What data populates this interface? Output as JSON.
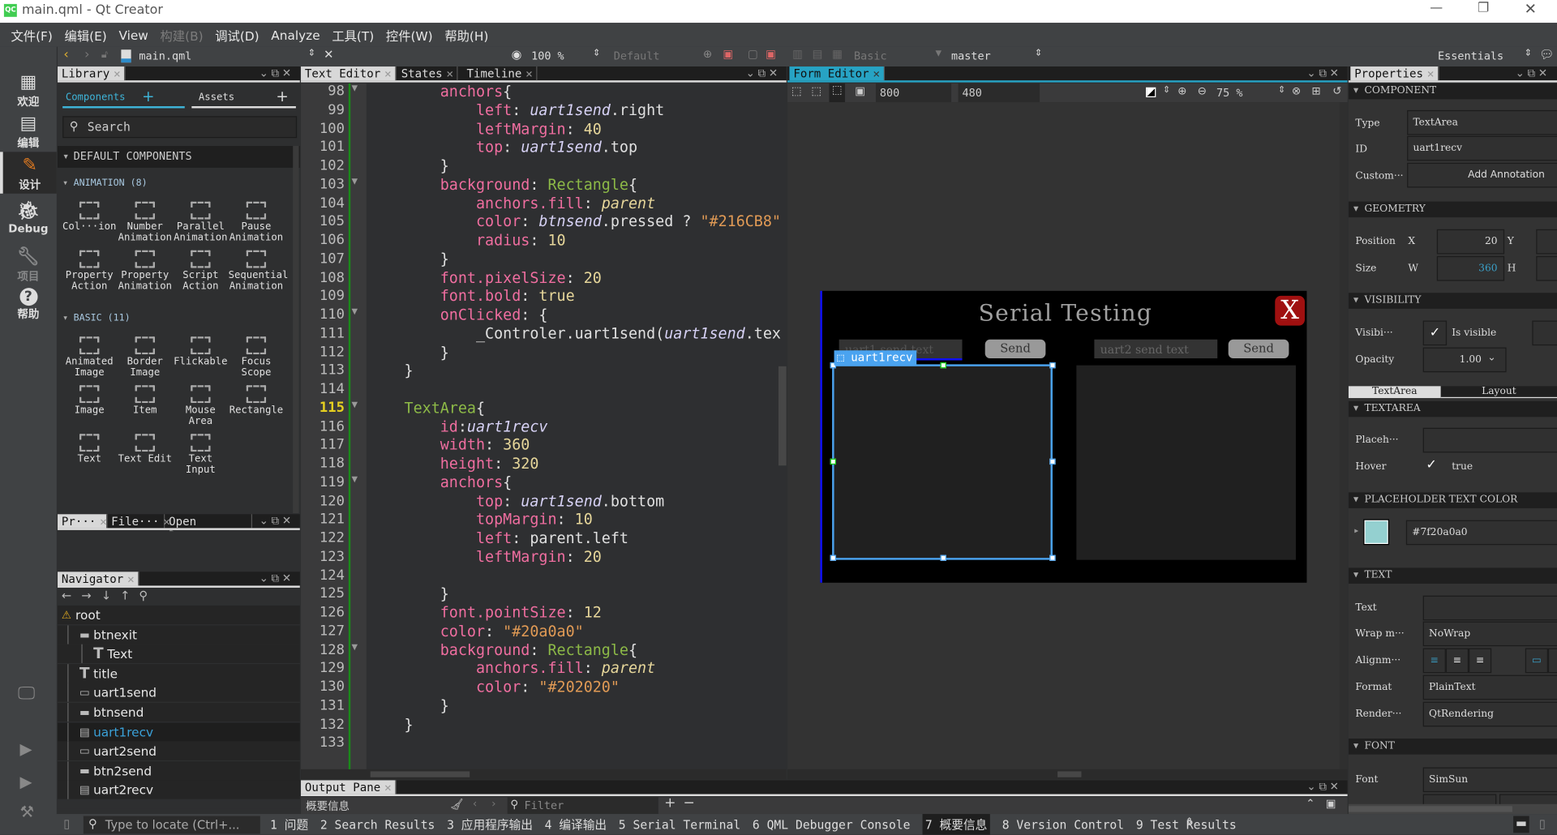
{
  "window": {
    "title": "main.qml - Qt Creator",
    "controls": [
      "minimize",
      "restore",
      "close"
    ]
  },
  "menu": [
    {
      "label": "文件(F)",
      "enabled": true
    },
    {
      "label": "编辑(E)",
      "enabled": true
    },
    {
      "label": "View",
      "enabled": true
    },
    {
      "label": "构建(B)",
      "enabled": false
    },
    {
      "label": "调试(D)",
      "enabled": true
    },
    {
      "label": "Analyze",
      "enabled": true
    },
    {
      "label": "工具(T)",
      "enabled": true
    },
    {
      "label": "控件(W)",
      "enabled": true
    },
    {
      "label": "帮助(H)",
      "enabled": true
    }
  ],
  "toolbar": {
    "file": "main.qml",
    "zoom": "100 %",
    "style": "Default",
    "theme": "Basic",
    "branch": "master",
    "workspace": "Essentials"
  },
  "modes": [
    {
      "label": "欢迎",
      "icon": "grid-icon"
    },
    {
      "label": "编辑",
      "icon": "document-icon"
    },
    {
      "label": "设计",
      "icon": "pencil-icon",
      "active": true
    },
    {
      "label": "Debug",
      "icon": "bug-icon"
    },
    {
      "label": "项目",
      "icon": "wrench-icon",
      "enabled": false
    },
    {
      "label": "帮助",
      "icon": "help-icon"
    }
  ],
  "library": {
    "tab": "Library",
    "subtabs": [
      "Components",
      "Assets"
    ],
    "search_placeholder": "Search",
    "default_header": "DEFAULT COMPONENTS",
    "groups": [
      {
        "title": "ANIMATION (8)",
        "items": [
          "Col···ion",
          "Number Animation",
          "Parallel Animation",
          "Pause Animation",
          "Property Action",
          "Property Animation",
          "Script Action",
          "Sequential Animation"
        ]
      },
      {
        "title": "BASIC (11)",
        "items": [
          "Animated Image",
          "Border Image",
          "Flickable",
          "Focus Scope",
          "Image",
          "Item",
          "Mouse Area",
          "Rectangle",
          "Text",
          "Text Edit",
          "Text Input"
        ]
      }
    ]
  },
  "lower_tabs": [
    "Pr···",
    "File···",
    "Open Do···"
  ],
  "navigator": {
    "tab": "Navigator",
    "items": [
      {
        "label": "root",
        "icon": "warning-icon",
        "depth": 0
      },
      {
        "label": "btnexit",
        "icon": "button-icon",
        "depth": 1
      },
      {
        "label": "Text",
        "icon": "text-icon",
        "depth": 2
      },
      {
        "label": "title",
        "icon": "text-icon",
        "depth": 1
      },
      {
        "label": "uart1send",
        "icon": "textfield-icon",
        "depth": 1
      },
      {
        "label": "btnsend",
        "icon": "button-icon",
        "depth": 1
      },
      {
        "label": "uart1recv",
        "icon": "textarea-icon",
        "depth": 1,
        "selected": true
      },
      {
        "label": "uart2send",
        "icon": "textfield-icon",
        "depth": 1
      },
      {
        "label": "btn2send",
        "icon": "button-icon",
        "depth": 1
      },
      {
        "label": "uart2recv",
        "icon": "textarea-icon",
        "depth": 1
      }
    ]
  },
  "editor_tabs": [
    "Text Editor",
    "States",
    "Timeline"
  ],
  "code": {
    "current_line": 115,
    "lines": [
      {
        "n": 98,
        "fold": true,
        "tokens": [
          [
            "        anchors",
            "p"
          ],
          [
            "{",
            "n"
          ]
        ]
      },
      {
        "n": 99,
        "tokens": [
          [
            "            left",
            "p"
          ],
          [
            ": ",
            "n"
          ],
          [
            "uart1send",
            "i"
          ],
          [
            ".right",
            "n"
          ]
        ]
      },
      {
        "n": 100,
        "tokens": [
          [
            "            leftMargin",
            "p"
          ],
          [
            ": ",
            "n"
          ],
          [
            "40",
            "v"
          ]
        ]
      },
      {
        "n": 101,
        "tokens": [
          [
            "            top",
            "p"
          ],
          [
            ": ",
            "n"
          ],
          [
            "uart1send",
            "i"
          ],
          [
            ".top",
            "n"
          ]
        ]
      },
      {
        "n": 102,
        "tokens": [
          [
            "        }",
            "n"
          ]
        ]
      },
      {
        "n": 103,
        "fold": true,
        "tokens": [
          [
            "        background",
            "p"
          ],
          [
            ": ",
            "n"
          ],
          [
            "Rectangle",
            "t"
          ],
          [
            "{",
            "n"
          ]
        ]
      },
      {
        "n": 104,
        "tokens": [
          [
            "            anchors.fill",
            "p"
          ],
          [
            ": ",
            "n"
          ],
          [
            "parent",
            "pi"
          ]
        ]
      },
      {
        "n": 105,
        "tokens": [
          [
            "            color",
            "p"
          ],
          [
            ": ",
            "n"
          ],
          [
            "btnsend",
            "i"
          ],
          [
            ".pressed ? ",
            "n"
          ],
          [
            "\"#216CB8\"",
            "s"
          ]
        ]
      },
      {
        "n": 106,
        "tokens": [
          [
            "            radius",
            "p"
          ],
          [
            ": ",
            "n"
          ],
          [
            "10",
            "v"
          ]
        ]
      },
      {
        "n": 107,
        "tokens": [
          [
            "        }",
            "n"
          ]
        ]
      },
      {
        "n": 108,
        "tokens": [
          [
            "        font.pixelSize",
            "p"
          ],
          [
            ": ",
            "n"
          ],
          [
            "20",
            "v"
          ]
        ]
      },
      {
        "n": 109,
        "tokens": [
          [
            "        font.bold",
            "p"
          ],
          [
            ": ",
            "n"
          ],
          [
            "true",
            "v"
          ]
        ]
      },
      {
        "n": 110,
        "fold": true,
        "tokens": [
          [
            "        onClicked",
            "p"
          ],
          [
            ": {",
            "n"
          ]
        ]
      },
      {
        "n": 111,
        "tokens": [
          [
            "            _Controler.uart1send(",
            "n"
          ],
          [
            "uart1send",
            "i"
          ],
          [
            ".tex",
            "n"
          ]
        ]
      },
      {
        "n": 112,
        "tokens": [
          [
            "        }",
            "n"
          ]
        ]
      },
      {
        "n": 113,
        "tokens": [
          [
            "    }",
            "n"
          ]
        ]
      },
      {
        "n": 114,
        "tokens": []
      },
      {
        "n": 115,
        "fold": true,
        "tokens": [
          [
            "    TextArea",
            "t"
          ],
          [
            "{",
            "n"
          ]
        ]
      },
      {
        "n": 116,
        "tokens": [
          [
            "        id",
            "p"
          ],
          [
            ":",
            "n"
          ],
          [
            "uart1recv",
            "i"
          ]
        ]
      },
      {
        "n": 117,
        "tokens": [
          [
            "        width",
            "p"
          ],
          [
            ": ",
            "n"
          ],
          [
            "360",
            "v"
          ]
        ]
      },
      {
        "n": 118,
        "tokens": [
          [
            "        height",
            "p"
          ],
          [
            ": ",
            "n"
          ],
          [
            "320",
            "v"
          ]
        ]
      },
      {
        "n": 119,
        "fold": true,
        "tokens": [
          [
            "        anchors",
            "p"
          ],
          [
            "{",
            "n"
          ]
        ]
      },
      {
        "n": 120,
        "tokens": [
          [
            "            top",
            "p"
          ],
          [
            ": ",
            "n"
          ],
          [
            "uart1send",
            "i"
          ],
          [
            ".bottom",
            "n"
          ]
        ]
      },
      {
        "n": 121,
        "tokens": [
          [
            "            topMargin",
            "p"
          ],
          [
            ": ",
            "n"
          ],
          [
            "10",
            "v"
          ]
        ]
      },
      {
        "n": 122,
        "tokens": [
          [
            "            left",
            "p"
          ],
          [
            ": ",
            "n"
          ],
          [
            "parent.left",
            "n"
          ]
        ]
      },
      {
        "n": 123,
        "tokens": [
          [
            "            leftMargin",
            "p"
          ],
          [
            ": ",
            "n"
          ],
          [
            "20",
            "v"
          ]
        ]
      },
      {
        "n": 124,
        "tokens": []
      },
      {
        "n": 125,
        "tokens": [
          [
            "        }",
            "n"
          ]
        ]
      },
      {
        "n": 126,
        "tokens": [
          [
            "        font.pointSize",
            "p"
          ],
          [
            ": ",
            "n"
          ],
          [
            "12",
            "v"
          ]
        ]
      },
      {
        "n": 127,
        "tokens": [
          [
            "        color",
            "p"
          ],
          [
            ": ",
            "n"
          ],
          [
            "\"#20a0a0\"",
            "s"
          ]
        ]
      },
      {
        "n": 128,
        "fold": true,
        "tokens": [
          [
            "        background",
            "p"
          ],
          [
            ": ",
            "n"
          ],
          [
            "Rectangle",
            "t"
          ],
          [
            "{",
            "n"
          ]
        ]
      },
      {
        "n": 129,
        "tokens": [
          [
            "            anchors.fill",
            "p"
          ],
          [
            ": ",
            "n"
          ],
          [
            "parent",
            "pi"
          ]
        ]
      },
      {
        "n": 130,
        "tokens": [
          [
            "            color",
            "p"
          ],
          [
            ": ",
            "n"
          ],
          [
            "\"#202020\"",
            "s"
          ]
        ]
      },
      {
        "n": 131,
        "tokens": [
          [
            "        }",
            "n"
          ]
        ]
      },
      {
        "n": 132,
        "tokens": [
          [
            "    }",
            "n"
          ]
        ]
      },
      {
        "n": 133,
        "tokens": []
      }
    ]
  },
  "form_editor": {
    "tab": "Form Editor",
    "width": "800",
    "height": "480",
    "zoom": "75 %",
    "app": {
      "title": "Serial Testing",
      "close_label": "X",
      "uart1_placeholder": "uart1 send text",
      "uart2_placeholder": "uart2 send text",
      "send_label": "Send",
      "send2_label": "Send",
      "selected_label": "uart1recv"
    }
  },
  "properties": {
    "tab": "Properties",
    "component_header": "COMPONENT",
    "type_label": "Type",
    "type_value": "TextArea",
    "id_label": "ID",
    "id_value": "uart1recv",
    "custom_label": "Custom···",
    "annotation_button": "Add Annotation",
    "geometry_header": "GEOMETRY",
    "position_label": "Position",
    "x_label": "X",
    "x_value": "20",
    "y_label": "Y",
    "size_label": "Size",
    "w_label": "W",
    "w_value": "360",
    "h_label": "H",
    "visibility_header": "VISIBILITY",
    "visible_label": "Visibi···",
    "visible_text": "Is visible",
    "visible": true,
    "opacity_label": "Opacity",
    "opacity_value": "1.00",
    "tabs": [
      "TextArea",
      "Layout"
    ],
    "textarea_header": "TEXTAREA",
    "placeholder_label": "Placeh···",
    "hover_label": "Hover",
    "hover_value": "true",
    "hover": true,
    "placeholder_color_header": "PLACEHOLDER TEXT COLOR",
    "placeholder_color": "#7f20a0a0",
    "swatch_color": "#94d0d0",
    "text_header": "TEXT",
    "text_label": "Text",
    "wrap_label": "Wrap m···",
    "wrap_value": "NoWrap",
    "align_label": "Alignm···",
    "format_label": "Format",
    "format_value": "PlainText",
    "render_label": "Render···",
    "render_value": "QtRendering",
    "font_header": "FONT",
    "font_label": "Font",
    "font_value": "SimSun"
  },
  "output": {
    "tab": "Output Pane",
    "current": "概要信息",
    "filter_placeholder": "Filter"
  },
  "statusbar": {
    "locator_placeholder": "Type to locate (Ctrl+...",
    "items": [
      "1 问题",
      "2 Search Results",
      "3 应用程序输出",
      "4 编译输出",
      "5 Serial Terminal",
      "6 QML Debugger Console",
      "7 概要信息",
      "8 Version Control",
      "9 Test Results"
    ],
    "active": 6
  }
}
